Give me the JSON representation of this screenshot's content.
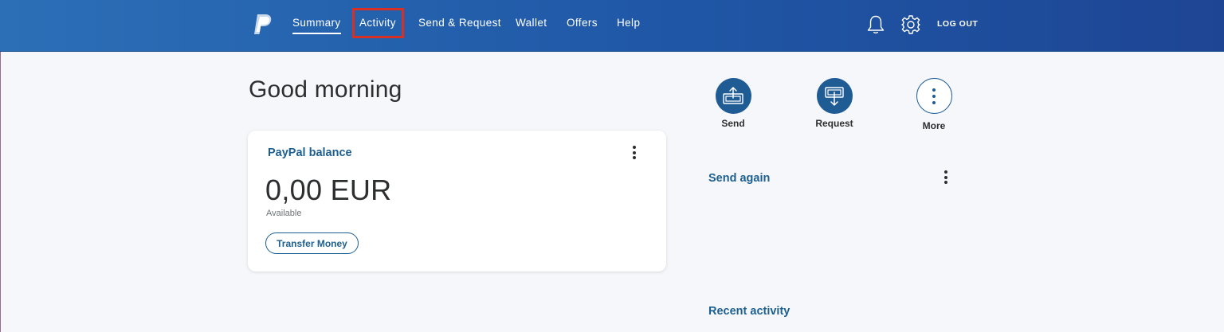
{
  "header": {
    "nav": [
      "Summary",
      "Activity",
      "Send & Request",
      "Wallet",
      "Offers",
      "Help"
    ],
    "active_nav": "Summary",
    "highlighted_nav": "Activity",
    "logout_label": "LOG OUT",
    "icons": [
      "paypal-logo",
      "bell-icon",
      "gear-icon"
    ]
  },
  "main": {
    "greeting": "Good morning",
    "balance_card": {
      "title": "PayPal balance",
      "amount": "0,00 EUR",
      "available_label": "Available",
      "transfer_button": "Transfer Money"
    }
  },
  "actions": {
    "send": "Send",
    "request": "Request",
    "more": "More"
  },
  "sections": {
    "send_again": "Send again",
    "recent_activity": "Recent activity"
  },
  "colors": {
    "header_start": "#2c6fb7",
    "header_end": "#1e4594",
    "accent": "#1d5f8f",
    "highlight_box": "#d93025",
    "background": "#f5f7fa"
  }
}
